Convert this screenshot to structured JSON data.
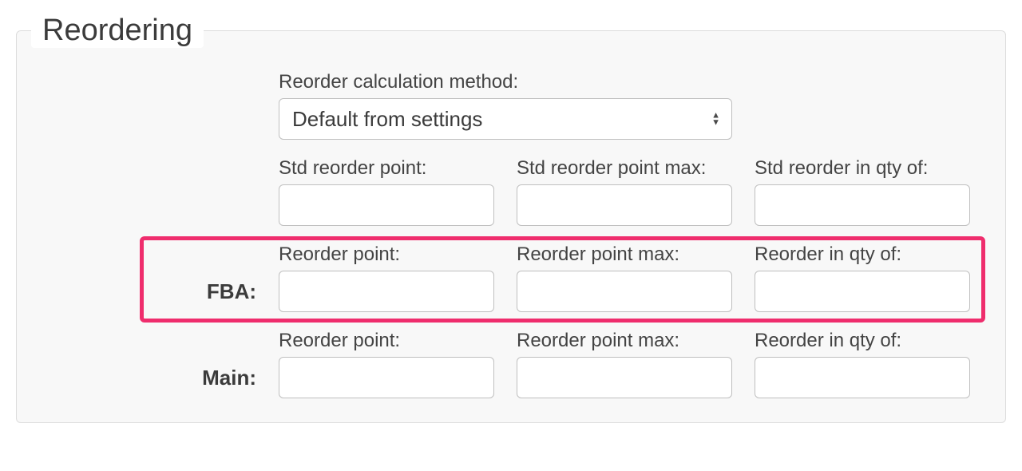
{
  "section": {
    "title": "Reordering"
  },
  "method": {
    "label": "Reorder calculation method:",
    "selected": "Default from settings"
  },
  "rows": {
    "std": {
      "label": "",
      "fields": [
        {
          "label": "Std reorder point:",
          "value": ""
        },
        {
          "label": "Std reorder point max:",
          "value": ""
        },
        {
          "label": "Std reorder in qty of:",
          "value": ""
        }
      ]
    },
    "fba": {
      "label": "FBA:",
      "fields": [
        {
          "label": "Reorder point:",
          "value": ""
        },
        {
          "label": "Reorder point max:",
          "value": ""
        },
        {
          "label": "Reorder in qty of:",
          "value": ""
        }
      ]
    },
    "main": {
      "label": "Main:",
      "fields": [
        {
          "label": "Reorder point:",
          "value": ""
        },
        {
          "label": "Reorder point max:",
          "value": ""
        },
        {
          "label": "Reorder in qty of:",
          "value": ""
        }
      ]
    }
  },
  "highlight": {
    "row": "fba"
  }
}
